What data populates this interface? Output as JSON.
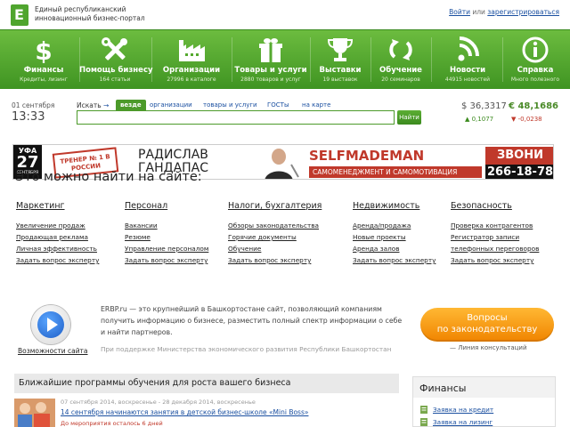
{
  "header": {
    "logo_letter": "E",
    "tagline_1": "Единый республиканский",
    "tagline_2": "инновационный бизнес-портал",
    "login": "Войти",
    "or": "или",
    "register": "зарегистрироваться"
  },
  "nav": [
    {
      "label": "Финансы",
      "sub": "Кредиты, лизинг",
      "icon": "dollar-icon"
    },
    {
      "label": "Помощь бизнесу",
      "sub": "164 статьи",
      "icon": "tools-icon"
    },
    {
      "label": "Организации",
      "sub": "27996 в каталоге",
      "icon": "factory-icon"
    },
    {
      "label": "Товары и услуги",
      "sub": "2880 товаров и услуг",
      "icon": "gift-icon"
    },
    {
      "label": "Выставки",
      "sub": "19 выставок",
      "icon": "trophy-icon"
    },
    {
      "label": "Обучение",
      "sub": "20 семинаров",
      "icon": "refresh-icon"
    },
    {
      "label": "Новости",
      "sub": "44915 новостей",
      "icon": "rss-icon"
    },
    {
      "label": "Справка",
      "sub": "Много полезного",
      "icon": "info-icon"
    }
  ],
  "datetime": {
    "date": "01 сентября",
    "time": "13:33"
  },
  "search": {
    "label": "Искать",
    "arrow": "→",
    "tabs": [
      "везде",
      "организации",
      "товары и услуги",
      "ГОСТы",
      "на карте"
    ],
    "value": "",
    "button": "Найти"
  },
  "currency": {
    "usd": "$ 36,3317",
    "eur": "€ 48,1686",
    "usd_change": "▲ 0,1077",
    "eur_change": "▼ -0,0238",
    "colors": {
      "up": "#3b8a1e",
      "down": "#c0392b"
    }
  },
  "banner": {
    "city": "УФА",
    "day": "27",
    "month": "СЕНТЯБРЯ",
    "trainer": "ТРЕНЕР № 1 В РОССИИ",
    "name_1": "РАДИСЛАВ",
    "name_2": "ГАНДАПАС",
    "brand": "SELFMADEMAN",
    "brand_sub": "САМОМЕНЕДЖМЕНТ И САМОМОТИВАЦИЯ",
    "call": "ЗВОНИ",
    "phone": "266-18-78"
  },
  "find": {
    "title": "Это можно найти на сайте:",
    "categories": [
      {
        "title": "Маркетинг",
        "links": [
          "Увеличение продаж",
          "Продающая реклама",
          "Личная эффективность",
          "Задать вопрос эксперту"
        ]
      },
      {
        "title": "Персонал",
        "links": [
          "Вакансии",
          "Резюме",
          "Управление персоналом",
          "Задать вопрос эксперту"
        ]
      },
      {
        "title": "Налоги, бухгалтерия",
        "links": [
          "Обзоры законодательства",
          "Горячие документы",
          "Обучение",
          "Задать вопрос эксперту"
        ]
      },
      {
        "title": "Недвижимость",
        "links": [
          "Аренда/продажа",
          "Новые проекты",
          "Аренда залов",
          "Задать вопрос эксперту"
        ]
      },
      {
        "title": "Безопасность",
        "links": [
          "Проверка контрагентов",
          "Регистратор записи",
          "телефонных переговоров",
          "Задать вопрос эксперту"
        ]
      }
    ]
  },
  "promo": {
    "possibilities": "Возможности сайта",
    "about": "ERBP.ru — это крупнейший в Башкортостане сайт, позволяющий компаниям получить информацию о бизнесе, разместить полный спектр информации о себе и найти партнеров.",
    "support": "При поддержке Министерства экономического развития Республики Башкортостан",
    "law_button_1": "Вопросы",
    "law_button_2": "по законодательству",
    "law_note": "— Линия консультаций"
  },
  "programs": {
    "title": "Ближайшие программы обучения для роста вашего бизнеса",
    "event": {
      "dates": "07 сентября 2014, воскресенье - 28 декабря 2014, воскресенье",
      "title": "14 сентября начинаются занятия в детской бизнес-школе «Mini Boss»",
      "left": "До мероприятия осталось 6 дней"
    }
  },
  "finance_box": {
    "title": "Финансы",
    "links": [
      "Заявка на кредит",
      "Заявка на лизинг"
    ]
  },
  "colors": {
    "green": "#4fa52e",
    "link": "#1a4fa0",
    "orange": "#f08400",
    "red": "#c0392b"
  }
}
